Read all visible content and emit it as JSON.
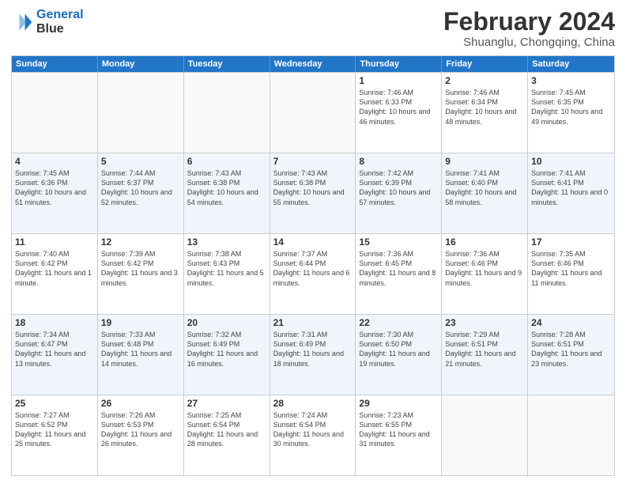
{
  "logo": {
    "line1": "General",
    "line2": "Blue"
  },
  "title": "February 2024",
  "subtitle": "Shuanglu, Chongqing, China",
  "headers": [
    "Sunday",
    "Monday",
    "Tuesday",
    "Wednesday",
    "Thursday",
    "Friday",
    "Saturday"
  ],
  "weeks": [
    [
      {
        "day": "",
        "sunrise": "",
        "sunset": "",
        "daylight": "",
        "empty": true
      },
      {
        "day": "",
        "sunrise": "",
        "sunset": "",
        "daylight": "",
        "empty": true
      },
      {
        "day": "",
        "sunrise": "",
        "sunset": "",
        "daylight": "",
        "empty": true
      },
      {
        "day": "",
        "sunrise": "",
        "sunset": "",
        "daylight": "",
        "empty": true
      },
      {
        "day": "1",
        "sunrise": "Sunrise: 7:46 AM",
        "sunset": "Sunset: 6:33 PM",
        "daylight": "Daylight: 10 hours and 46 minutes."
      },
      {
        "day": "2",
        "sunrise": "Sunrise: 7:46 AM",
        "sunset": "Sunset: 6:34 PM",
        "daylight": "Daylight: 10 hours and 48 minutes."
      },
      {
        "day": "3",
        "sunrise": "Sunrise: 7:45 AM",
        "sunset": "Sunset: 6:35 PM",
        "daylight": "Daylight: 10 hours and 49 minutes."
      }
    ],
    [
      {
        "day": "4",
        "sunrise": "Sunrise: 7:45 AM",
        "sunset": "Sunset: 6:36 PM",
        "daylight": "Daylight: 10 hours and 51 minutes."
      },
      {
        "day": "5",
        "sunrise": "Sunrise: 7:44 AM",
        "sunset": "Sunset: 6:37 PM",
        "daylight": "Daylight: 10 hours and 52 minutes."
      },
      {
        "day": "6",
        "sunrise": "Sunrise: 7:43 AM",
        "sunset": "Sunset: 6:38 PM",
        "daylight": "Daylight: 10 hours and 54 minutes."
      },
      {
        "day": "7",
        "sunrise": "Sunrise: 7:43 AM",
        "sunset": "Sunset: 6:38 PM",
        "daylight": "Daylight: 10 hours and 55 minutes."
      },
      {
        "day": "8",
        "sunrise": "Sunrise: 7:42 AM",
        "sunset": "Sunset: 6:39 PM",
        "daylight": "Daylight: 10 hours and 57 minutes."
      },
      {
        "day": "9",
        "sunrise": "Sunrise: 7:41 AM",
        "sunset": "Sunset: 6:40 PM",
        "daylight": "Daylight: 10 hours and 58 minutes."
      },
      {
        "day": "10",
        "sunrise": "Sunrise: 7:41 AM",
        "sunset": "Sunset: 6:41 PM",
        "daylight": "Daylight: 11 hours and 0 minutes."
      }
    ],
    [
      {
        "day": "11",
        "sunrise": "Sunrise: 7:40 AM",
        "sunset": "Sunset: 6:42 PM",
        "daylight": "Daylight: 11 hours and 1 minute."
      },
      {
        "day": "12",
        "sunrise": "Sunrise: 7:39 AM",
        "sunset": "Sunset: 6:42 PM",
        "daylight": "Daylight: 11 hours and 3 minutes."
      },
      {
        "day": "13",
        "sunrise": "Sunrise: 7:38 AM",
        "sunset": "Sunset: 6:43 PM",
        "daylight": "Daylight: 11 hours and 5 minutes."
      },
      {
        "day": "14",
        "sunrise": "Sunrise: 7:37 AM",
        "sunset": "Sunset: 6:44 PM",
        "daylight": "Daylight: 11 hours and 6 minutes."
      },
      {
        "day": "15",
        "sunrise": "Sunrise: 7:36 AM",
        "sunset": "Sunset: 6:45 PM",
        "daylight": "Daylight: 11 hours and 8 minutes."
      },
      {
        "day": "16",
        "sunrise": "Sunrise: 7:36 AM",
        "sunset": "Sunset: 6:46 PM",
        "daylight": "Daylight: 11 hours and 9 minutes."
      },
      {
        "day": "17",
        "sunrise": "Sunrise: 7:35 AM",
        "sunset": "Sunset: 6:46 PM",
        "daylight": "Daylight: 11 hours and 11 minutes."
      }
    ],
    [
      {
        "day": "18",
        "sunrise": "Sunrise: 7:34 AM",
        "sunset": "Sunset: 6:47 PM",
        "daylight": "Daylight: 11 hours and 13 minutes."
      },
      {
        "day": "19",
        "sunrise": "Sunrise: 7:33 AM",
        "sunset": "Sunset: 6:48 PM",
        "daylight": "Daylight: 11 hours and 14 minutes."
      },
      {
        "day": "20",
        "sunrise": "Sunrise: 7:32 AM",
        "sunset": "Sunset: 6:49 PM",
        "daylight": "Daylight: 11 hours and 16 minutes."
      },
      {
        "day": "21",
        "sunrise": "Sunrise: 7:31 AM",
        "sunset": "Sunset: 6:49 PM",
        "daylight": "Daylight: 11 hours and 18 minutes."
      },
      {
        "day": "22",
        "sunrise": "Sunrise: 7:30 AM",
        "sunset": "Sunset: 6:50 PM",
        "daylight": "Daylight: 11 hours and 19 minutes."
      },
      {
        "day": "23",
        "sunrise": "Sunrise: 7:29 AM",
        "sunset": "Sunset: 6:51 PM",
        "daylight": "Daylight: 11 hours and 21 minutes."
      },
      {
        "day": "24",
        "sunrise": "Sunrise: 7:28 AM",
        "sunset": "Sunset: 6:51 PM",
        "daylight": "Daylight: 11 hours and 23 minutes."
      }
    ],
    [
      {
        "day": "25",
        "sunrise": "Sunrise: 7:27 AM",
        "sunset": "Sunset: 6:52 PM",
        "daylight": "Daylight: 11 hours and 25 minutes."
      },
      {
        "day": "26",
        "sunrise": "Sunrise: 7:26 AM",
        "sunset": "Sunset: 6:53 PM",
        "daylight": "Daylight: 11 hours and 26 minutes."
      },
      {
        "day": "27",
        "sunrise": "Sunrise: 7:25 AM",
        "sunset": "Sunset: 6:54 PM",
        "daylight": "Daylight: 11 hours and 28 minutes."
      },
      {
        "day": "28",
        "sunrise": "Sunrise: 7:24 AM",
        "sunset": "Sunset: 6:54 PM",
        "daylight": "Daylight: 11 hours and 30 minutes."
      },
      {
        "day": "29",
        "sunrise": "Sunrise: 7:23 AM",
        "sunset": "Sunset: 6:55 PM",
        "daylight": "Daylight: 11 hours and 31 minutes."
      },
      {
        "day": "",
        "sunrise": "",
        "sunset": "",
        "daylight": "",
        "empty": true
      },
      {
        "day": "",
        "sunrise": "",
        "sunset": "",
        "daylight": "",
        "empty": true
      }
    ]
  ]
}
